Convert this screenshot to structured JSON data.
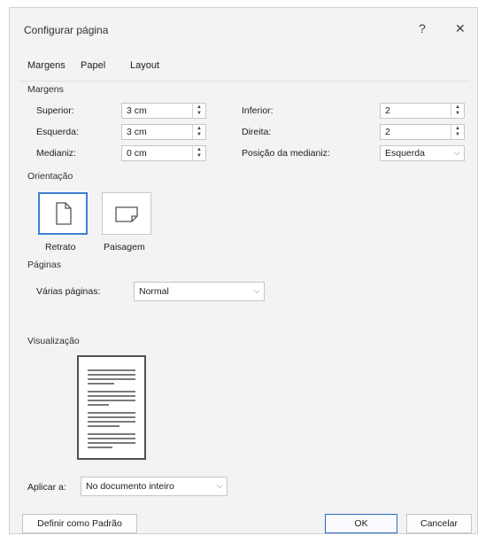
{
  "window": {
    "title": "Configurar página",
    "help_icon": "question-icon",
    "close_icon": "close-icon",
    "help_glyph": "?",
    "close_glyph": "✕"
  },
  "tabs": [
    "Margens",
    "Papel",
    "Layout"
  ],
  "margins": {
    "group_label": "Margens",
    "superior": {
      "label": "Superior:",
      "value": "3 cm"
    },
    "esquerda": {
      "label": "Esquerda:",
      "value": "3 cm"
    },
    "medianiz": {
      "label": "Medianiz:",
      "value": "0 cm"
    },
    "inferior": {
      "label": "Inferior:",
      "value": "2"
    },
    "direita": {
      "label": "Direita:",
      "value": "2"
    },
    "posicao_medianiz": {
      "label": "Posição da medianiz:",
      "value": "Esquerda"
    }
  },
  "orientation": {
    "group_label": "Orientação",
    "retrato_label": "Retrato",
    "paisagem_label": "Paisagem",
    "selected": "Retrato"
  },
  "pages": {
    "group_label": "Páginas",
    "varias_label": "Várias páginas:",
    "varias_value": "Normal"
  },
  "preview": {
    "group_label": "Visualização"
  },
  "apply": {
    "label": "Aplicar a:",
    "value": "No documento inteiro"
  },
  "buttons": {
    "default": "Definir como Padrão",
    "ok": "OK",
    "cancel": "Cancelar"
  },
  "colors": {
    "accent": "#3d7fd4",
    "dialog_bg": "#f3f3f3"
  }
}
